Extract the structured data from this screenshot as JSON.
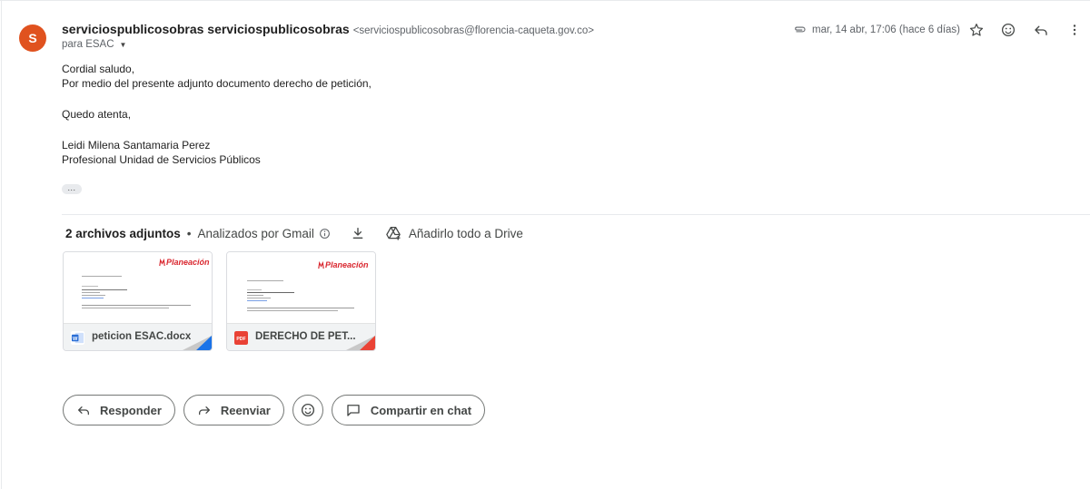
{
  "sender": {
    "avatar_letter": "S",
    "avatar_color": "#e0521f",
    "name": "serviciospublicosobras serviciospublicosobras",
    "email": "<serviciospublicosobras@florencia-caqueta.gov.co>",
    "to_label": "para ESAC"
  },
  "meta": {
    "attachment_icon": "paperclip-icon",
    "date": "mar, 14 abr, 17:06 (hace 6 días)"
  },
  "header_icons": [
    "star-icon",
    "emoji-icon",
    "reply-icon",
    "more-vert-icon"
  ],
  "body": {
    "greeting": "Cordial saludo,",
    "line1": "Por medio del presente adjunto documento derecho de petición,",
    "closing": "Quedo atenta,",
    "signature_name": "Leidi Milena Santamaria Perez",
    "signature_title": "Profesional Unidad de Servicios Públicos",
    "trimmed_icon": "..."
  },
  "attachments_bar": {
    "count_label": "2 archivos adjuntos",
    "separator": "•",
    "scanned_label": "Analizados por Gmail",
    "drive_label": "Añadirlo todo a Drive"
  },
  "attachments": [
    {
      "name": "peticion ESAC.docx",
      "type": "word",
      "type_color": "#2b6fd6",
      "corner_color": "#1a73e8",
      "logo_text": "Planeación"
    },
    {
      "name": "DERECHO DE PET...",
      "type": "pdf",
      "type_label": "PDF",
      "type_color": "#e94235",
      "corner_color": "#ea4335",
      "logo_text": "Planeación"
    }
  ],
  "actions": {
    "reply": "Responder",
    "forward": "Reenviar",
    "emoji_icon": "emoji-icon",
    "share": "Compartir en chat"
  }
}
